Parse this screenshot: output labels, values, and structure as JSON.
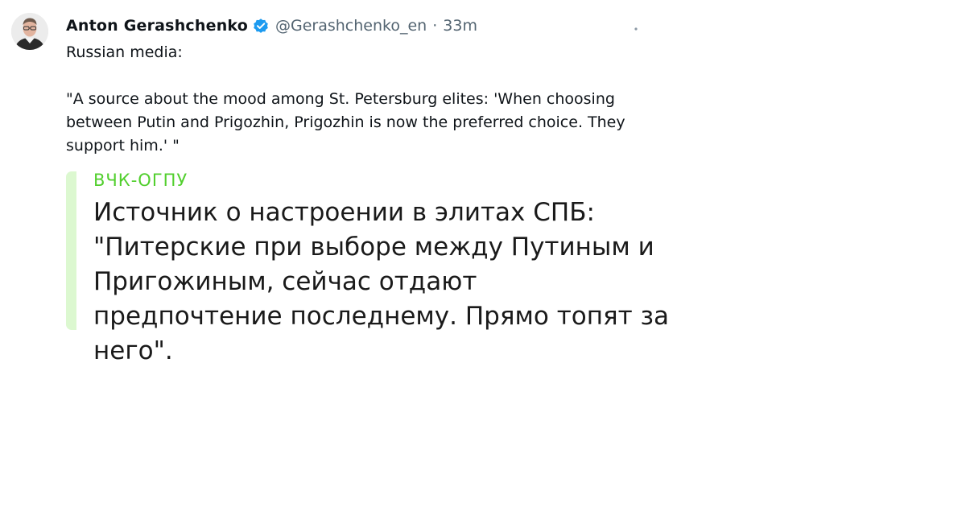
{
  "author": {
    "display_name": "Anton Gerashchenko",
    "handle": "@Gerashchenko_en",
    "separator": "·",
    "time": "33m"
  },
  "tweet": {
    "intro": "Russian media:",
    "quote_en": "\"A source about the mood among St. Petersburg elites: 'When choosing between Putin and Prigozhin, Prigozhin is now the preferred choice. They support him.' \""
  },
  "quoted_post": {
    "channel": "ВЧК-ОГПУ",
    "text": "Источник о настроении в элитах СПБ: \"Питерские при выборе между Путиным и Пригожиным, сейчас отдают предпочтение последнему. Прямо топят за него\"."
  },
  "icons": {
    "verified": "verified-badge-icon",
    "more": "more-options-icon"
  },
  "colors": {
    "verified": "#1d9bf0",
    "channel_green": "#52cf2e",
    "quote_bar": "#dcf8d0",
    "secondary_text": "#536471"
  }
}
